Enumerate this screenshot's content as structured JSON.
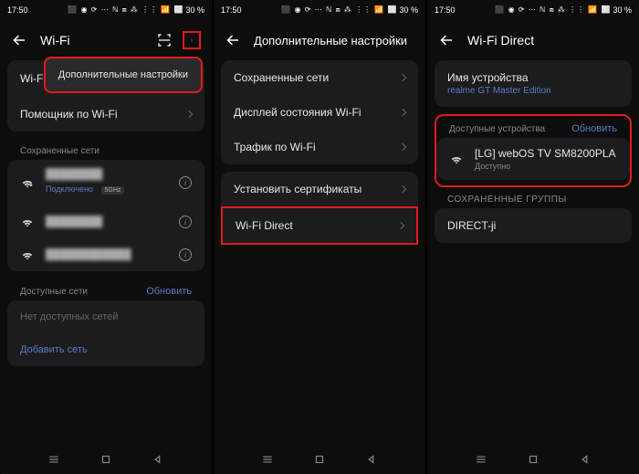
{
  "status": {
    "time": "17:50",
    "battery": "30 %",
    "icons": "⬛ ◉ ⟳ ⋯   ℕ ⧈ ⁂ ⋮⋮ 📶 ⬜"
  },
  "screen1": {
    "title": "Wi-Fi",
    "popup": "Дополнительные настройки",
    "wifi_label": "Wi-Fi",
    "assistant": "Помощник по Wi-Fi",
    "saved_header": "Сохраненные сети",
    "net1_sub": "Подключено",
    "net1_badge": "5GHz",
    "available_header": "Доступные сети",
    "refresh": "Обновить",
    "no_networks": "Нет доступных сетей",
    "add_network": "Добавить сеть"
  },
  "screen2": {
    "title": "Дополнительные настройки",
    "saved": "Сохраненные сети",
    "display": "Дисплей состояния Wi-Fi",
    "traffic": "Трафик по Wi-Fi",
    "certs": "Установить сертификаты",
    "direct": "Wi-Fi Direct"
  },
  "screen3": {
    "title": "Wi-Fi Direct",
    "device_label": "Имя устройства",
    "device_name": "realme GT Master Edition",
    "available_header": "Доступные устройства",
    "refresh": "Обновить",
    "found_device": "[LG] webOS TV SM8200PLA",
    "found_status": "Доступно",
    "saved_groups": "СОХРАНЕННЫЕ ГРУППЫ",
    "group1": "DIRECT-ji"
  }
}
